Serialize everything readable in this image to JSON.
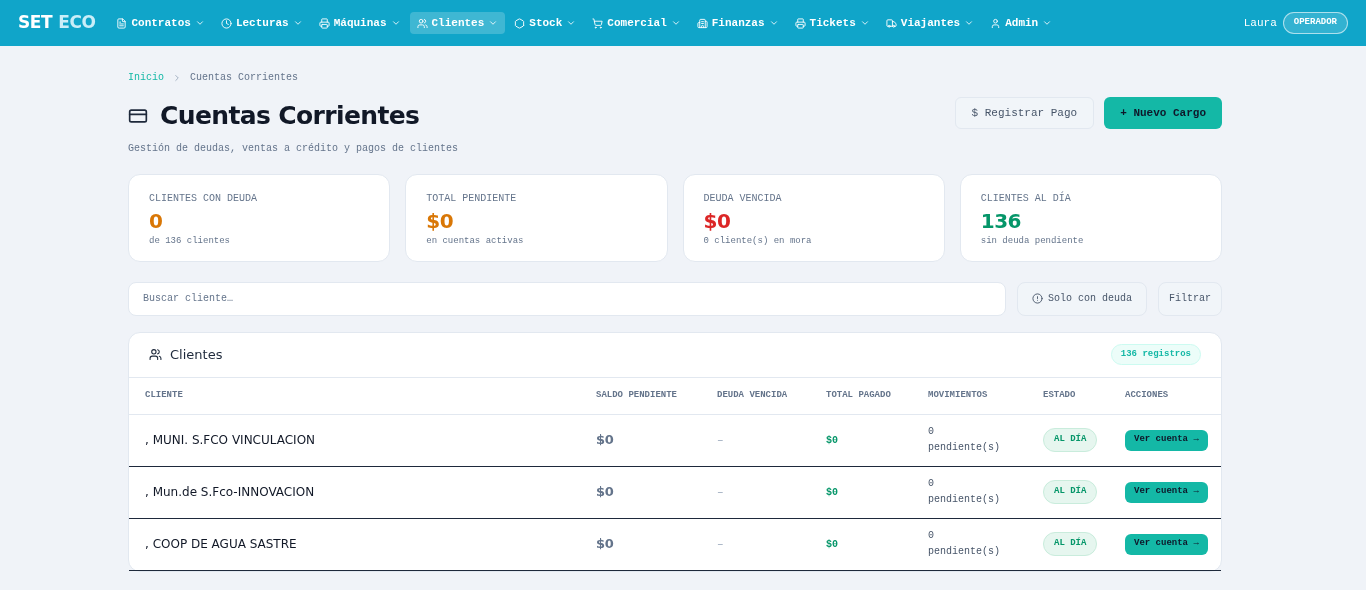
{
  "brand": {
    "part_1": "SET",
    "part_2": "ECO"
  },
  "nav": [
    {
      "label": "Contratos",
      "selected": false
    },
    {
      "label": "Lecturas",
      "selected": false
    },
    {
      "label": "Máquinas",
      "selected": false
    },
    {
      "label": "Clientes",
      "selected": true
    },
    {
      "label": "Stock",
      "selected": false
    },
    {
      "label": "Comercial",
      "selected": false
    },
    {
      "label": "Finanzas",
      "selected": false
    },
    {
      "label": "Tickets",
      "selected": false
    },
    {
      "label": "Viajantes",
      "selected": false
    },
    {
      "label": "Admin",
      "selected": false
    }
  ],
  "user": {
    "name": "Laura",
    "role": "OPERADOR"
  },
  "breadcrumb": [
    "Inicio",
    "Cuentas Corrientes"
  ],
  "page": {
    "title": "Cuentas Corrientes",
    "subtitle": "Gestión de deudas, ventas a crédito y pagos de clientes"
  },
  "actions": [
    {
      "kind": "outline",
      "icon": "$",
      "label": "Registrar Pago"
    },
    {
      "kind": "primary",
      "icon": "+",
      "label": "Nuevo Cargo"
    }
  ],
  "stats": [
    {
      "label": "CLIENTES CON DEUDA",
      "value": "0",
      "note": "de 136 clientes",
      "color": "#d97706"
    },
    {
      "label": "TOTAL PENDIENTE",
      "value": "$0",
      "note": "en cuentas activas",
      "color": "#d97706"
    },
    {
      "label": "DEUDA VENCIDA",
      "value": "$0",
      "note": "0 cliente(s) en mora",
      "color": "#dc2626"
    },
    {
      "label": "CLIENTES AL DÍA",
      "value": "136",
      "note": "sin deuda pendiente",
      "color": "#059669"
    }
  ],
  "search": {
    "placeholder": "Buscar cliente…"
  },
  "filters": {
    "only_debt": "Solo con deuda",
    "filter": "Filtrar"
  },
  "table": {
    "title": "Clientes",
    "count": "136 registros",
    "columns": [
      "CLIENTE",
      "SALDO PENDIENTE",
      "DEUDA VENCIDA",
      "TOTAL PAGADO",
      "MOVIMIENTOS",
      "ESTADO",
      "ACCIONES"
    ],
    "rows": [
      {
        "client": ", MUNI. S.FCO VINCULACION",
        "balance": "$0",
        "overdue": "–",
        "paid": "$0",
        "movements": "0",
        "pending": "pendiente(s)",
        "status": "AL DÍA",
        "action": "Ver cuenta →"
      },
      {
        "client": ", Mun.de S.Fco-INNOVACION",
        "balance": "$0",
        "overdue": "–",
        "paid": "$0",
        "movements": "0",
        "pending": "pendiente(s)",
        "status": "AL DÍA",
        "action": "Ver cuenta →"
      },
      {
        "client": ", COOP DE AGUA SASTRE",
        "balance": "$0",
        "overdue": "–",
        "paid": "$0",
        "movements": "0",
        "pending": "pendiente(s)",
        "status": "AL DÍA",
        "action": "Ver cuenta →"
      }
    ]
  }
}
